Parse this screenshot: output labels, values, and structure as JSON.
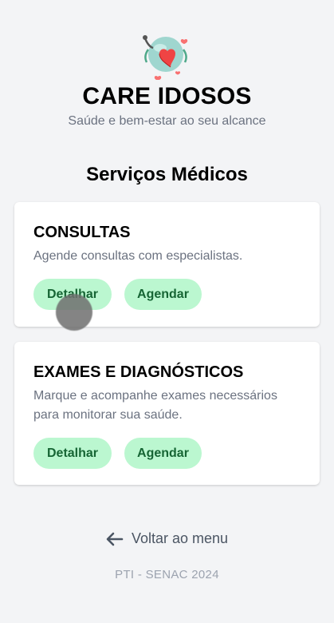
{
  "header": {
    "logo_icon": "elderly-care-heart-stethoscope-icon",
    "title": "CARE IDOSOS",
    "subtitle": "Saúde e bem-estar ao seu alcance"
  },
  "section": {
    "title": "Serviços Médicos"
  },
  "cards": [
    {
      "title": "CONSULTAS",
      "description": "Agende consultas com especialistas.",
      "detail_label": "Detalhar",
      "schedule_label": "Agendar"
    },
    {
      "title": "EXAMES E DIAGNÓSTICOS",
      "description": "Marque e acompanhe exames necessários para monitorar sua saúde.",
      "detail_label": "Detalhar",
      "schedule_label": "Agendar"
    }
  ],
  "navigation": {
    "back_icon": "arrow-left-icon",
    "back_label": "Voltar ao menu"
  },
  "footer": {
    "text": "PTI - SENAC 2024"
  },
  "colors": {
    "background": "#f3f4f6",
    "button_bg": "#bbf7d0",
    "button_text": "#166534",
    "muted_text": "#6b7280"
  }
}
